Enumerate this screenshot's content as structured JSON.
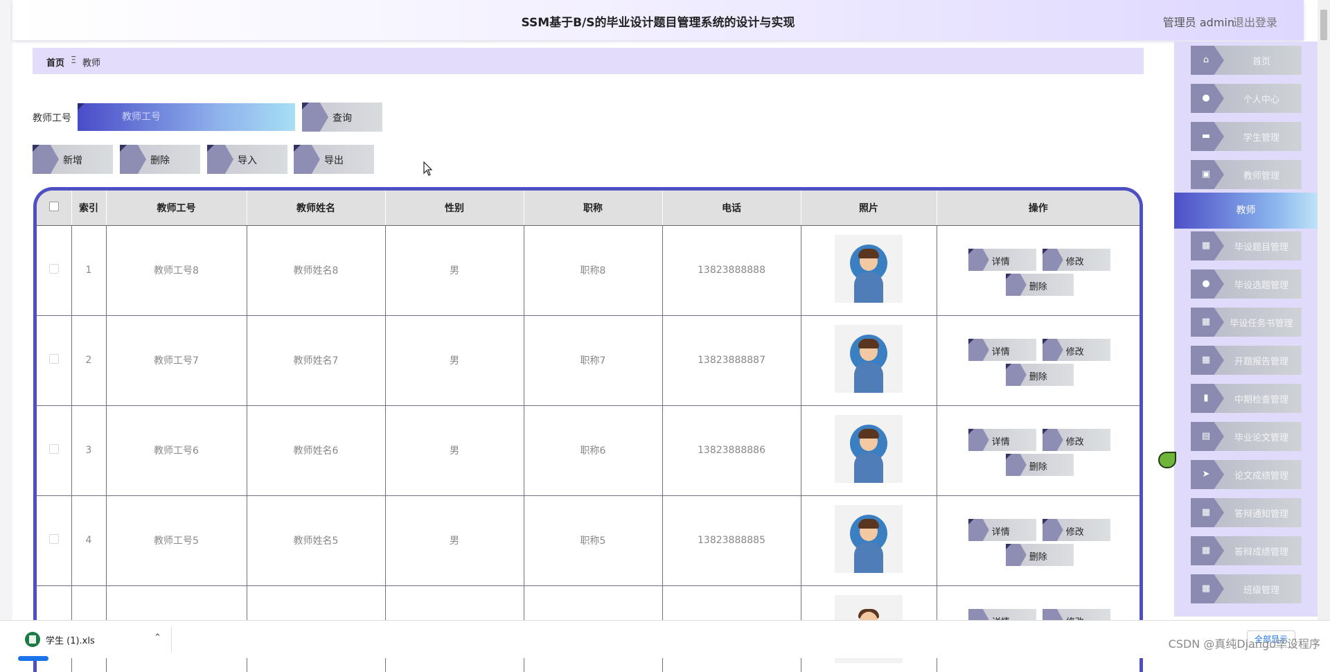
{
  "header": {
    "title": "SSM基于B/S的毕业设计题目管理系统的设计与实现",
    "user": "管理员 admin",
    "logout": "退出登录"
  },
  "breadcrumb": {
    "home": "首页",
    "separator": "Ξ",
    "current": "教师"
  },
  "search": {
    "label": "教师工号",
    "placeholder": "教师工号",
    "button": "查询"
  },
  "toolbar": {
    "add": "新增",
    "delete": "删除",
    "import": "导入",
    "export": "导出"
  },
  "table": {
    "headers": {
      "index": "索引",
      "teacher_id": "教师工号",
      "teacher_name": "教师姓名",
      "gender": "性别",
      "title": "职称",
      "phone": "电话",
      "photo": "照片",
      "actions": "操作"
    },
    "rows": [
      {
        "index": "1",
        "teacher_id": "教师工号8",
        "teacher_name": "教师姓名8",
        "gender": "男",
        "title": "职称8",
        "phone": "13823888888"
      },
      {
        "index": "2",
        "teacher_id": "教师工号7",
        "teacher_name": "教师姓名7",
        "gender": "男",
        "title": "职称7",
        "phone": "13823888887"
      },
      {
        "index": "3",
        "teacher_id": "教师工号6",
        "teacher_name": "教师姓名6",
        "gender": "男",
        "title": "职称6",
        "phone": "13823888886"
      },
      {
        "index": "4",
        "teacher_id": "教师工号5",
        "teacher_name": "教师姓名5",
        "gender": "男",
        "title": "职称5",
        "phone": "13823888885"
      }
    ],
    "row_actions": {
      "detail": "详情",
      "edit": "修改",
      "delete": "删除"
    }
  },
  "sidebar": {
    "items": [
      {
        "label": "首页",
        "icon": "home-icon"
      },
      {
        "label": "个人中心",
        "icon": "user-icon"
      },
      {
        "label": "学生管理",
        "icon": "monitor-icon"
      },
      {
        "label": "教师管理",
        "icon": "clipboard-icon"
      }
    ],
    "active": "教师",
    "items_after": [
      {
        "label": "毕设题目管理",
        "icon": "grid-icon"
      },
      {
        "label": "毕设选题管理",
        "icon": "user-icon"
      },
      {
        "label": "毕设任务书管理",
        "icon": "grid-icon"
      },
      {
        "label": "开题报告管理",
        "icon": "grid-icon"
      },
      {
        "label": "中期检查管理",
        "icon": "bar-chart-icon"
      },
      {
        "label": "毕业论文管理",
        "icon": "briefcase-icon"
      },
      {
        "label": "论文成绩管理",
        "icon": "send-icon"
      },
      {
        "label": "答辩通知管理",
        "icon": "grid-icon"
      },
      {
        "label": "答辩成绩管理",
        "icon": "grid-icon"
      },
      {
        "label": "班级管理",
        "icon": "grid-icon"
      }
    ]
  },
  "download_bar": {
    "file_name": "学生 (1).xls",
    "show_all": "全部显示"
  },
  "watermark": "CSDN @真纯Django毕设程序"
}
